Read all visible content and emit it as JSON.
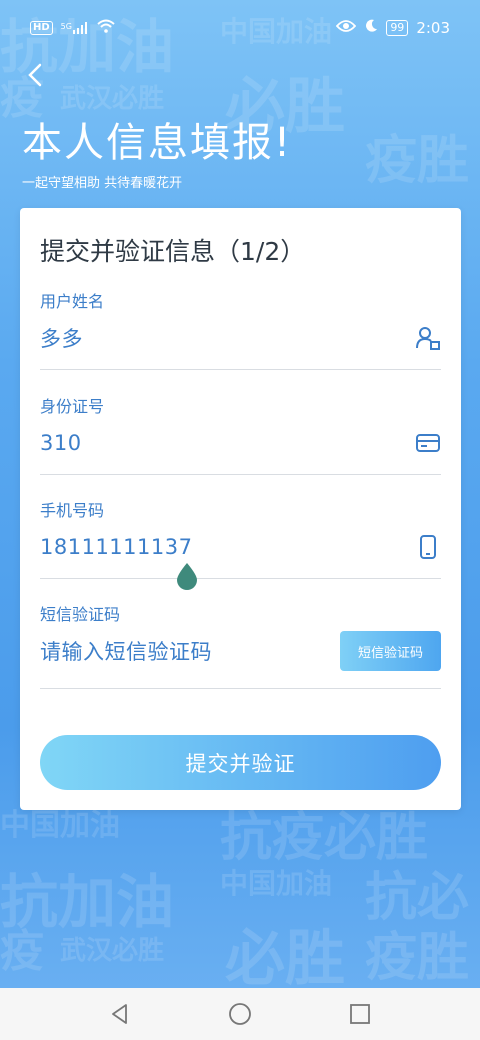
{
  "status_bar": {
    "hd": "HD",
    "network": "5G",
    "battery": "99",
    "time": "2:03"
  },
  "background_text": [
    "抗加油",
    "中国加油",
    "疫",
    "武汉必胜",
    "必胜",
    "疫胜",
    "中国加油",
    "抗疫必胜",
    "抗加油",
    "中国加油",
    "抗必",
    "疫",
    "武汉必胜",
    "必胜",
    "疫胜"
  ],
  "header": {
    "title": "本人信息填报!",
    "subtitle": "一起守望相助 共待春暖花开"
  },
  "form": {
    "title": "提交并验证信息（1/2）",
    "name": {
      "label": "用户姓名",
      "value": "多多",
      "icon": "user-icon"
    },
    "id_number": {
      "label": "身份证号",
      "value": "310",
      "icon": "id-card-icon"
    },
    "phone": {
      "label": "手机号码",
      "value": "18111111137",
      "icon": "phone-icon"
    },
    "sms_code": {
      "label": "短信验证码",
      "placeholder": "请输入短信验证码",
      "button_label": "短信验证码"
    },
    "submit_label": "提交并验证"
  },
  "colors": {
    "accent": "#3c7ec9",
    "button_gradient_start": "#80d6f6",
    "button_gradient_end": "#4e9ef0",
    "cursor_handle": "#3f8a7c"
  }
}
